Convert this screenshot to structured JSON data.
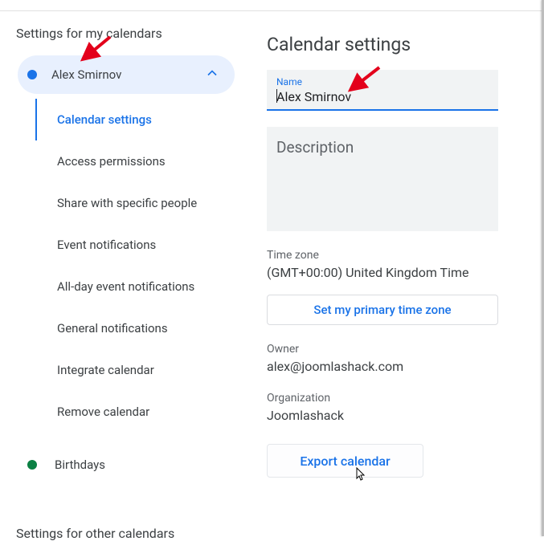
{
  "sidebar": {
    "section_my": "Settings for my calendars",
    "calendar_name": "Alex Smirnov",
    "items": [
      "Calendar settings",
      "Access permissions",
      "Share with specific people",
      "Event notifications",
      "All-day event notifications",
      "General notifications",
      "Integrate calendar",
      "Remove calendar"
    ],
    "birthdays": "Birthdays",
    "section_other": "Settings for other calendars"
  },
  "main": {
    "title": "Calendar settings",
    "name_label": "Name",
    "name_value": "Alex Smirnov",
    "description_label": "Description",
    "tz_label": "Time zone",
    "tz_value": "(GMT+00:00) United Kingdom Time",
    "tz_button": "Set my primary time zone",
    "owner_label": "Owner",
    "owner_value": "alex@joomlashack.com",
    "org_label": "Organization",
    "org_value": "Joomlashack",
    "export_button": "Export calendar"
  }
}
